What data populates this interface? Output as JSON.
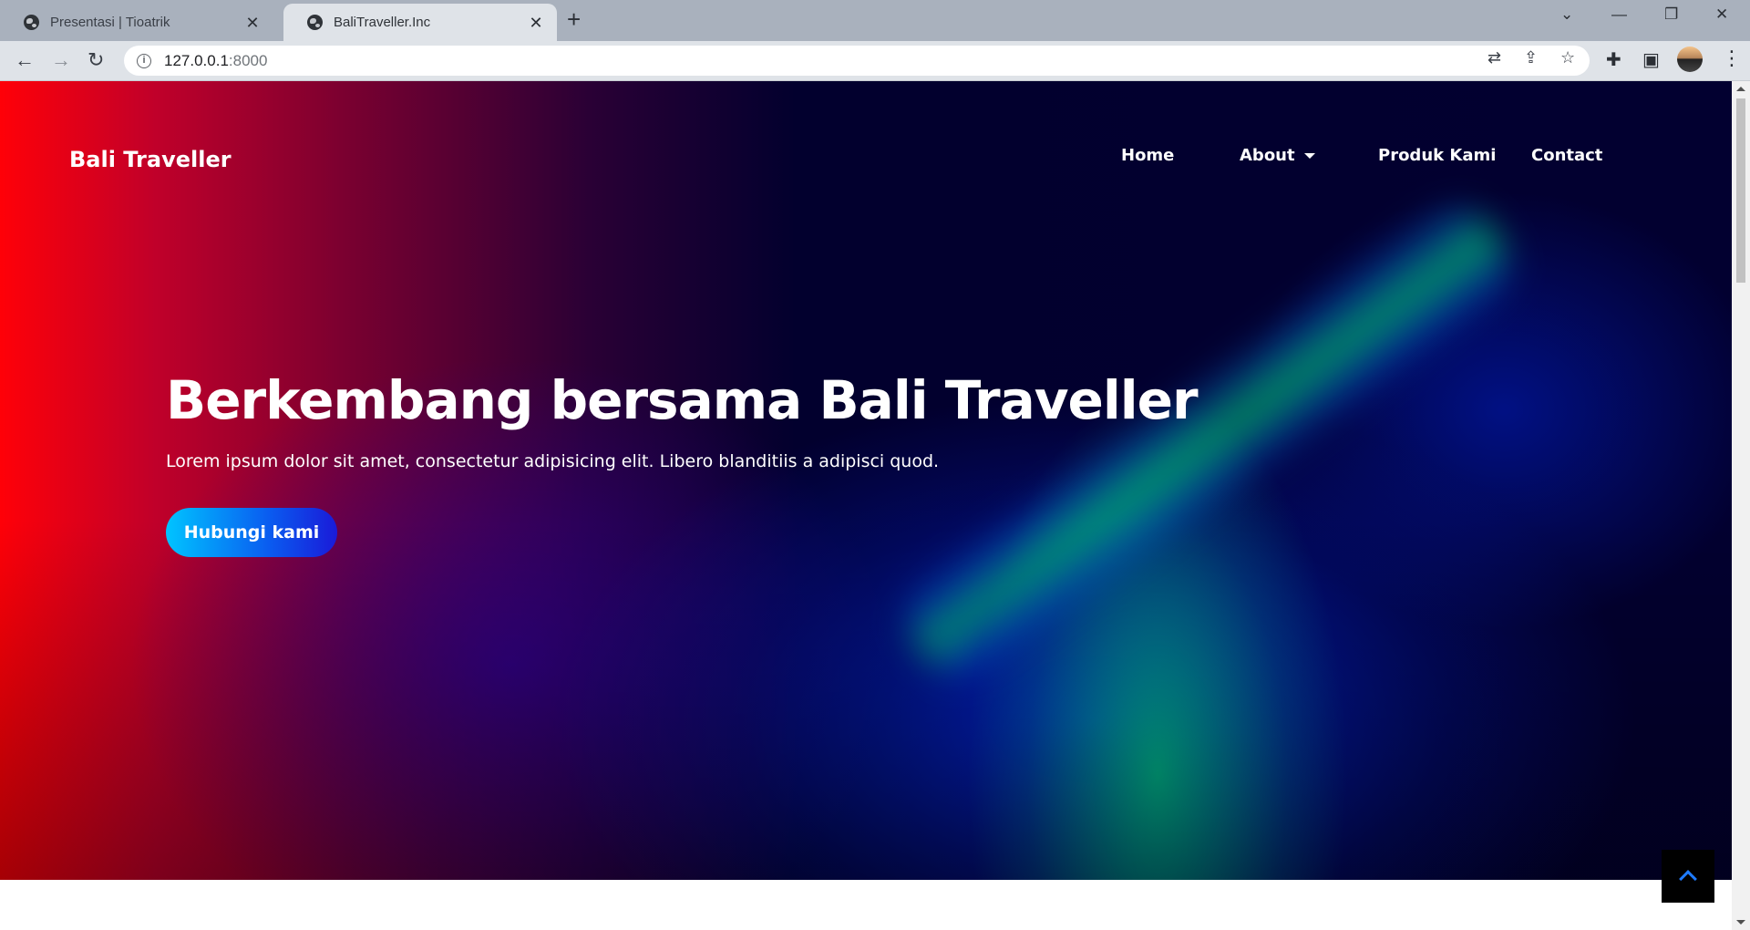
{
  "browser": {
    "tabs": [
      {
        "title": "Presentasi | Tioatrik",
        "active": false
      },
      {
        "title": "BaliTraveller.Inc",
        "active": true
      }
    ],
    "address": {
      "host": "127.0.0.1",
      "port": ":8000"
    }
  },
  "site": {
    "brand": "Bali Traveller",
    "nav": {
      "home": "Home",
      "about": "About",
      "products": "Produk Kami",
      "contact": "Contact"
    },
    "hero": {
      "headline": "Berkembang bersama Bali Traveller",
      "subtext": "Lorem ipsum dolor sit amet, consectetur adipisicing elit. Libero blanditiis a adipisci quod.",
      "cta": "Hubungi kami"
    }
  },
  "colors": {
    "cta_start": "#00c4ff",
    "cta_end": "#1a1ad8",
    "back_to_top_chevron": "#1e7bff"
  },
  "icons": {
    "tab_favicon": "globe-icon",
    "back": "arrow-left-icon",
    "forward": "arrow-right-icon",
    "reload": "reload-icon",
    "site_info": "info-icon",
    "translate": "translate-icon",
    "share": "share-icon",
    "bookmark": "star-icon",
    "extensions": "puzzle-icon",
    "side_panel": "side-panel-icon",
    "menu": "more-vert-icon",
    "back_to_top": "chevron-up-icon"
  }
}
